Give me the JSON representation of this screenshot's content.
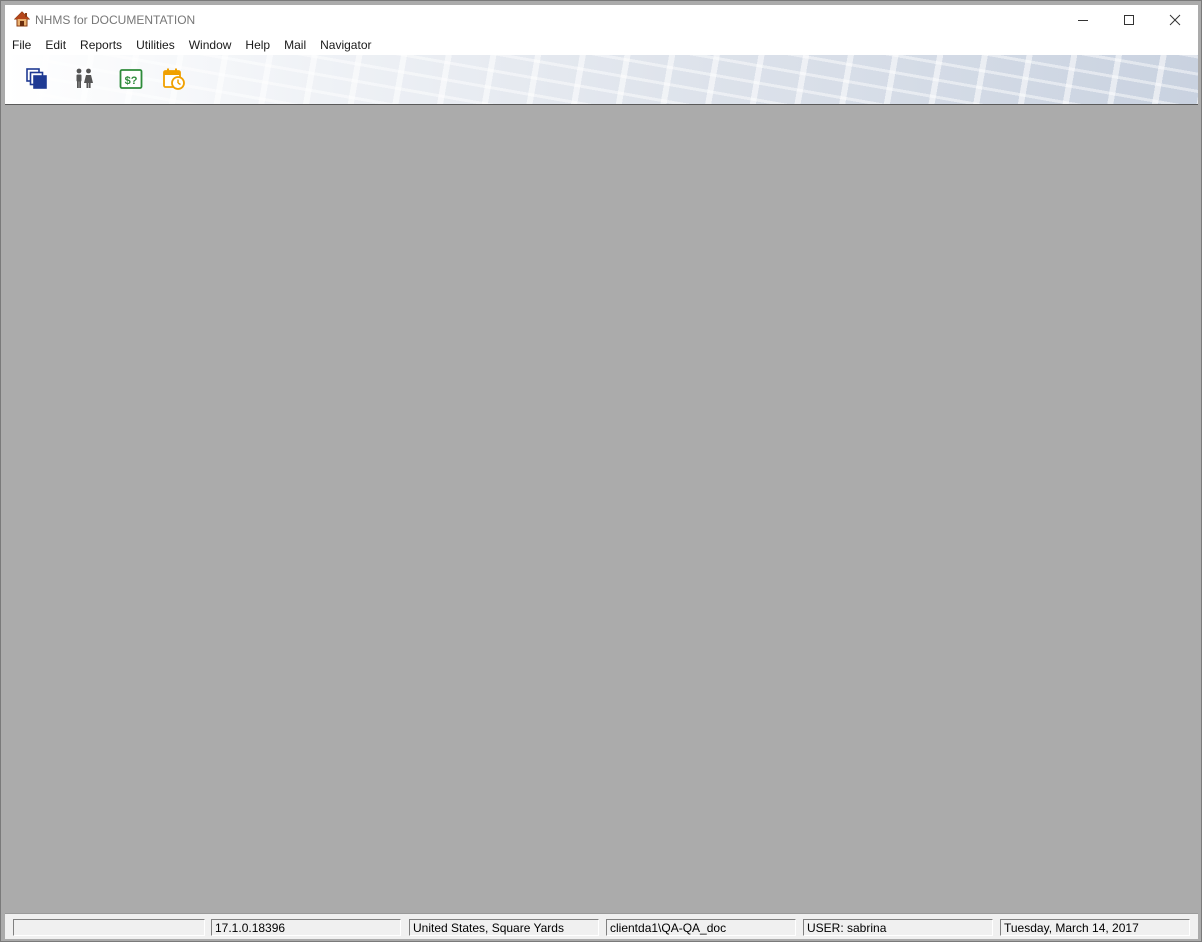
{
  "window": {
    "title": "NHMS for DOCUMENTATION",
    "controls": {
      "minimize": "minimize-icon",
      "maximize": "maximize-icon",
      "close": "close-icon"
    }
  },
  "menubar": {
    "items": [
      {
        "label": "File"
      },
      {
        "label": "Edit"
      },
      {
        "label": "Reports"
      },
      {
        "label": "Utilities"
      },
      {
        "label": "Window"
      },
      {
        "label": "Help"
      },
      {
        "label": "Mail"
      },
      {
        "label": "Navigator"
      }
    ]
  },
  "toolbar": {
    "buttons": [
      {
        "icon": "cascade-windows-icon",
        "color": "#1f3a93"
      },
      {
        "icon": "people-icon",
        "color": "#555555"
      },
      {
        "icon": "price-query-icon",
        "color": "#2e8b3a",
        "glyph": "$?"
      },
      {
        "icon": "calendar-clock-icon",
        "color": "#f0a000"
      }
    ]
  },
  "statusbar": {
    "panels": [
      {
        "text": ""
      },
      {
        "text": "17.1.0.18396"
      },
      {
        "text": "United States, Square Yards"
      },
      {
        "text": "clientda1\\QA-QA_doc"
      },
      {
        "text": "USER:  sabrina"
      },
      {
        "text": "Tuesday, March 14, 2017"
      }
    ]
  },
  "colors": {
    "workspace": "#ababab",
    "titlebar": "#ffffff",
    "statusbar": "#f0f0f0"
  }
}
